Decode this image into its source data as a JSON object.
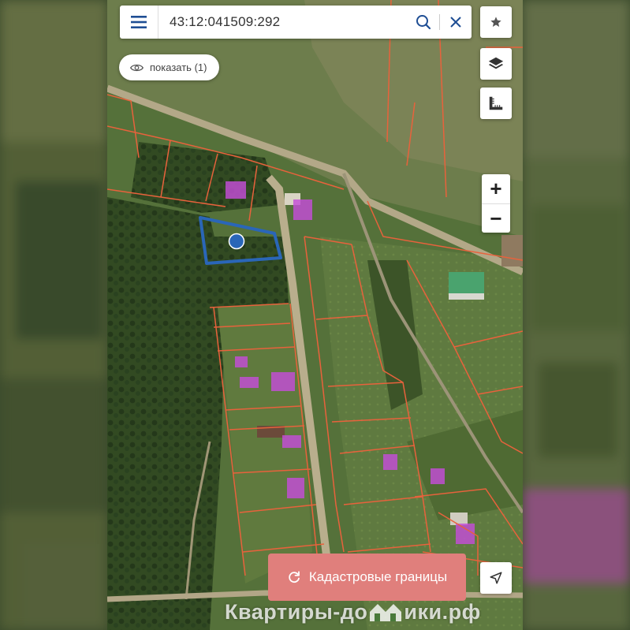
{
  "search": {
    "query": "43:12:041509:292"
  },
  "show_button": {
    "label": "показать (1)"
  },
  "controls": {
    "zoom_in": "+",
    "zoom_out": "−"
  },
  "cadastre_button": {
    "label": "Кадастровые границы"
  },
  "watermark": {
    "part1": "Квартиры-до",
    "part2": "ики.рф"
  },
  "icons": {
    "menu": "menu-icon",
    "search": "search-icon",
    "close": "close-icon",
    "favorite": "star-icon",
    "layers": "layers-icon",
    "measure": "ruler-icon",
    "show": "eye-icon",
    "refresh": "refresh-icon",
    "locate": "location-arrow-icon"
  },
  "colors": {
    "accent": "#1f4e94",
    "parcel_border": "#e8623c",
    "selected_parcel": "#2a66b8",
    "building_fill": "#c44dd8",
    "cadastre_button": "#e07f7c"
  }
}
